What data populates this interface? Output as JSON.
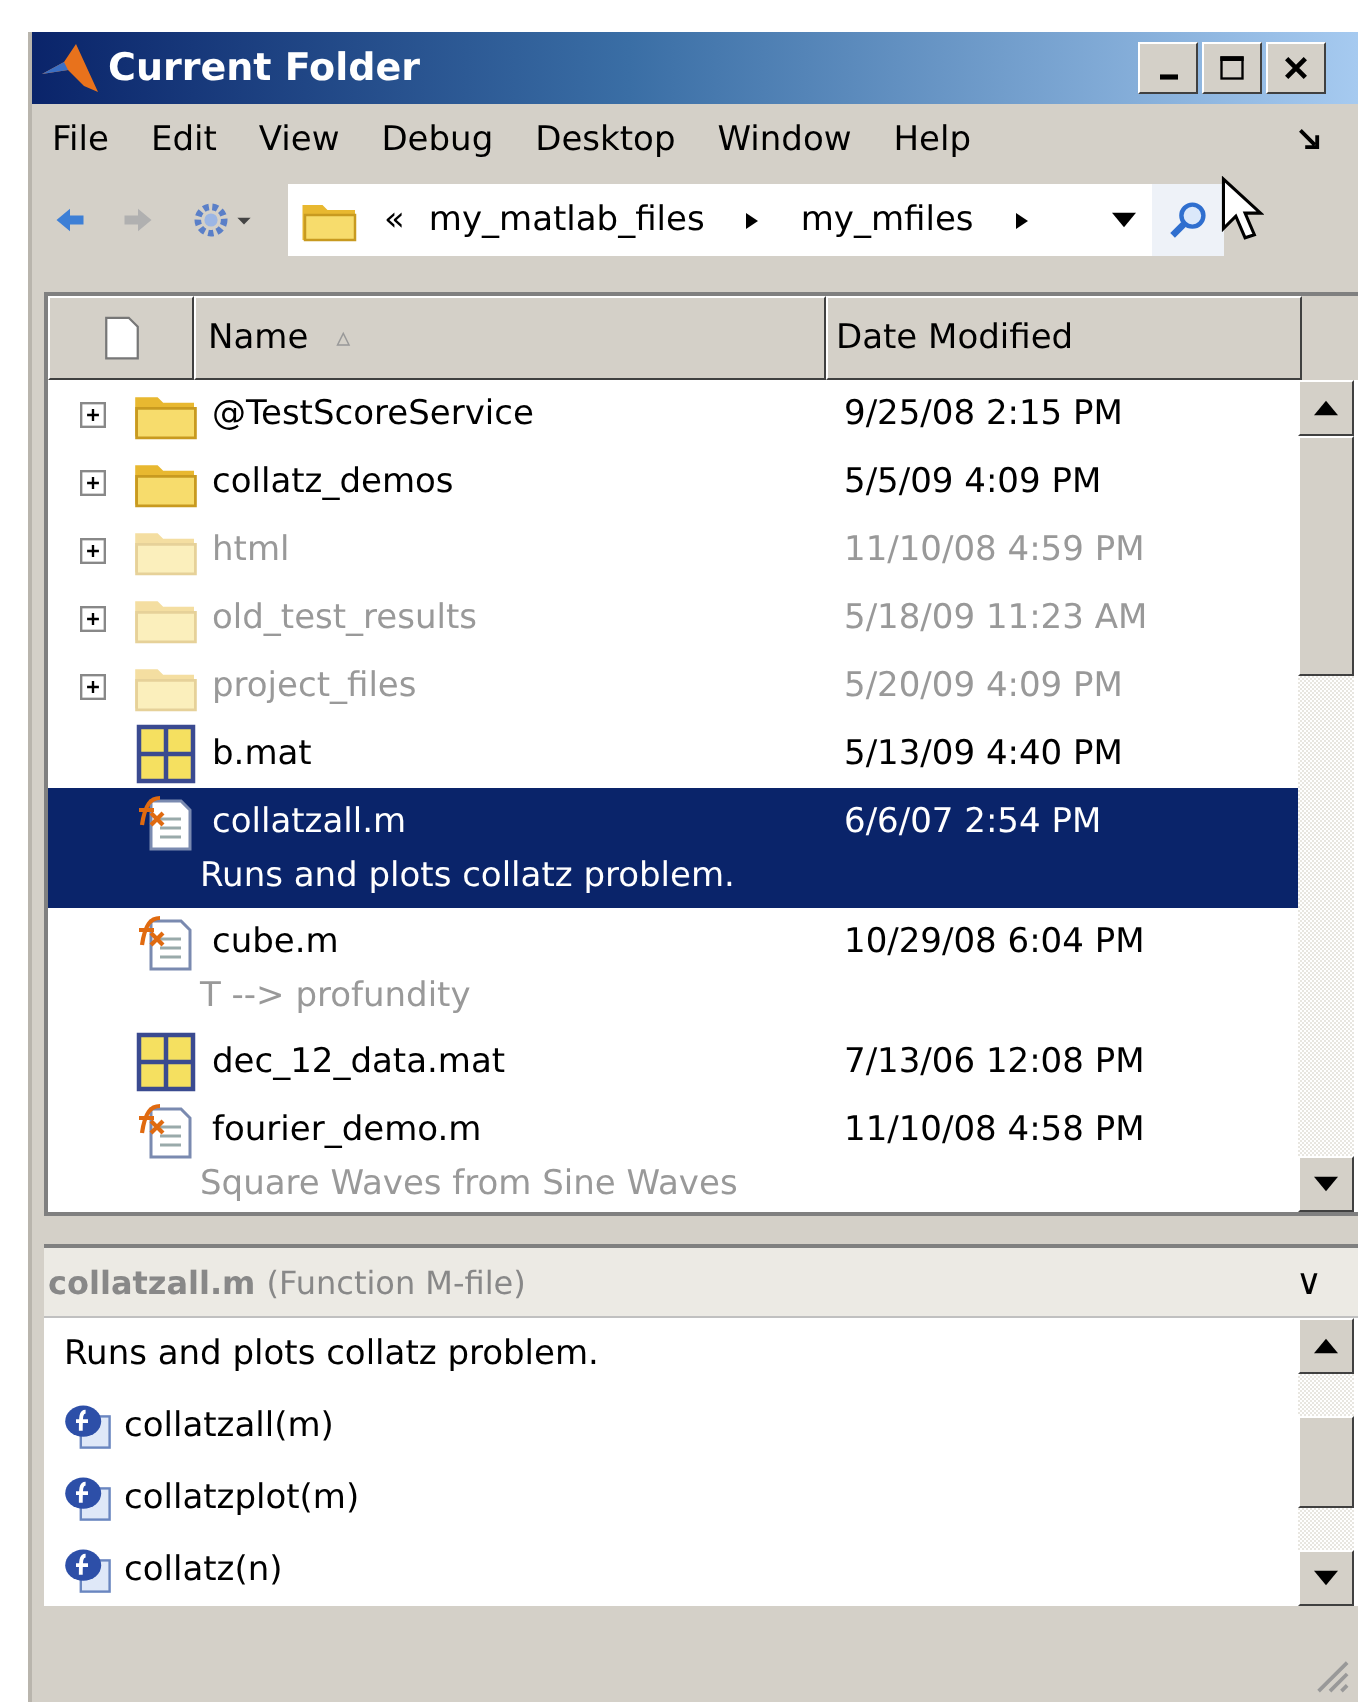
{
  "window": {
    "title": "Current Folder"
  },
  "menu": [
    "File",
    "Edit",
    "View",
    "Debug",
    "Desktop",
    "Window",
    "Help"
  ],
  "address": {
    "overflow": "«",
    "path": [
      "my_matlab_files",
      "my_mfiles"
    ]
  },
  "table": {
    "columns": [
      {
        "label": "Name",
        "sort": "▵"
      },
      {
        "label": "Date Modified"
      }
    ],
    "rows": [
      {
        "kind": "folder",
        "name": "@TestScoreService",
        "date": "9/25/08 2:15 PM",
        "dimmed": false,
        "selected": false,
        "expanded": false
      },
      {
        "kind": "folder",
        "name": "collatz_demos",
        "date": "5/5/09 4:09 PM",
        "dimmed": false,
        "selected": false,
        "expanded": false
      },
      {
        "kind": "folder",
        "name": "html",
        "date": "11/10/08 4:59 PM",
        "dimmed": true,
        "selected": false,
        "expanded": false
      },
      {
        "kind": "folder",
        "name": "old_test_results",
        "date": "5/18/09 11:23 AM",
        "dimmed": true,
        "selected": false,
        "expanded": false
      },
      {
        "kind": "folder",
        "name": "project_files",
        "date": "5/20/09 4:09 PM",
        "dimmed": true,
        "selected": false,
        "expanded": false
      },
      {
        "kind": "mat",
        "name": "b.mat",
        "date": "5/13/09 4:40 PM",
        "dimmed": false,
        "selected": false
      },
      {
        "kind": "mfile",
        "name": "collatzall.m",
        "date": "6/6/07 2:54 PM",
        "description": "Runs and plots collatz problem.",
        "dimmed": false,
        "selected": true
      },
      {
        "kind": "mfile",
        "name": "cube.m",
        "date": "10/29/08 6:04 PM",
        "description": "T --> profundity",
        "dimmed": false,
        "selected": false
      },
      {
        "kind": "mat",
        "name": "dec_12_data.mat",
        "date": "7/13/06 12:08 PM",
        "dimmed": false,
        "selected": false
      },
      {
        "kind": "mfile",
        "name": "fourier_demo.m",
        "date": "11/10/08 4:58 PM",
        "description": "Square Waves from Sine Waves",
        "dimmed": false,
        "selected": false
      }
    ]
  },
  "details": {
    "file": "collatzall.m",
    "type": "(Function M-file)",
    "collapse": "∨",
    "description": "Runs and plots collatz problem.",
    "functions": [
      "collatzall(m)",
      "collatzplot(m)",
      "collatz(n)"
    ]
  }
}
